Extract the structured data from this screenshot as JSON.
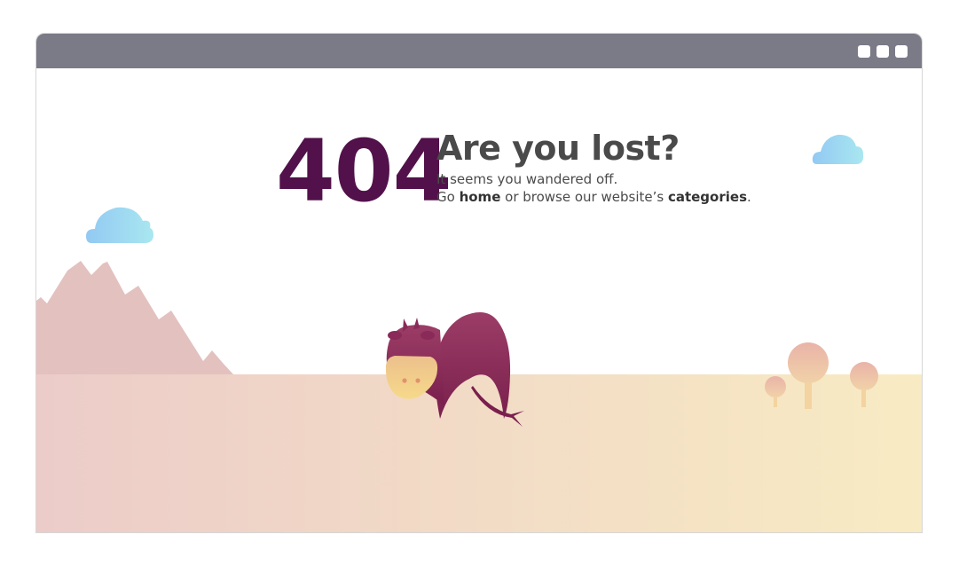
{
  "window": {
    "controls": [
      "minimize",
      "maximize",
      "close"
    ]
  },
  "error": {
    "code": "404",
    "heading": "Are you lost?",
    "line1": "It seems you wandered off.",
    "line2_prefix": "Go ",
    "home_link": "home",
    "line2_middle": " or browse our website’s ",
    "categories_link": "categories",
    "line2_suffix": "."
  },
  "colors": {
    "titlebar": "#7b7a87",
    "code": "#52114a",
    "text": "#4a4a4a",
    "cow": "#892a58",
    "mountain": "#e3c1bf",
    "ground_left": "#ecccc9",
    "ground_right": "#f8ebc3",
    "cloud": "#9fd3f2"
  }
}
